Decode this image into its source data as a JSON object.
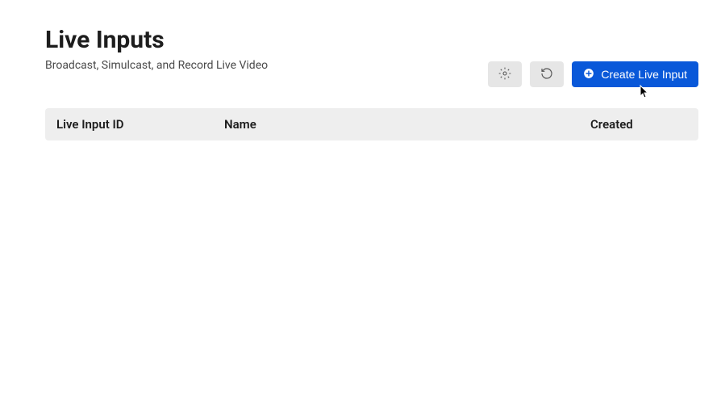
{
  "header": {
    "title": "Live Inputs",
    "subtitle": "Broadcast, Simulcast, and Record Live Video"
  },
  "actions": {
    "settings_label": "Settings",
    "refresh_label": "Refresh",
    "create_label": "Create Live Input"
  },
  "table": {
    "columns": {
      "id": "Live Input ID",
      "name": "Name",
      "created": "Created"
    },
    "rows": []
  }
}
